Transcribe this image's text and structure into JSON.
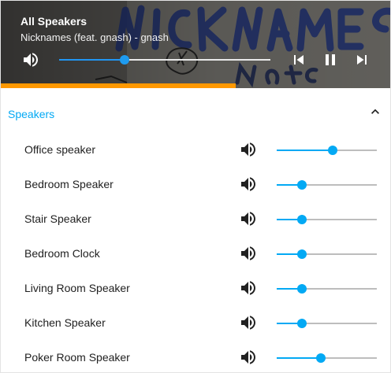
{
  "now_playing": {
    "title": "All Speakers",
    "subtitle": "Nicknames (feat. gnash) - gnash",
    "master_volume": 0.31,
    "track_progress": 0.6,
    "icons": {
      "mute": "volume-icon",
      "prev": "skip-previous-icon",
      "pause": "pause-icon",
      "next": "skip-next-icon"
    },
    "colors": {
      "progress": "#ff9800",
      "slider": "#2196f3"
    }
  },
  "speakers_section": {
    "title": "Speakers",
    "collapse_icon": "chevron-up-icon",
    "accent": "#03a9f4",
    "items": [
      {
        "label": "Office speaker",
        "volume": 0.56
      },
      {
        "label": "Bedroom Speaker",
        "volume": 0.25
      },
      {
        "label": "Stair Speaker",
        "volume": 0.25
      },
      {
        "label": "Bedroom Clock",
        "volume": 0.25
      },
      {
        "label": "Living Room Speaker",
        "volume": 0.25
      },
      {
        "label": "Kitchen Speaker",
        "volume": 0.25
      },
      {
        "label": "Poker Room Speaker",
        "volume": 0.44
      }
    ]
  }
}
